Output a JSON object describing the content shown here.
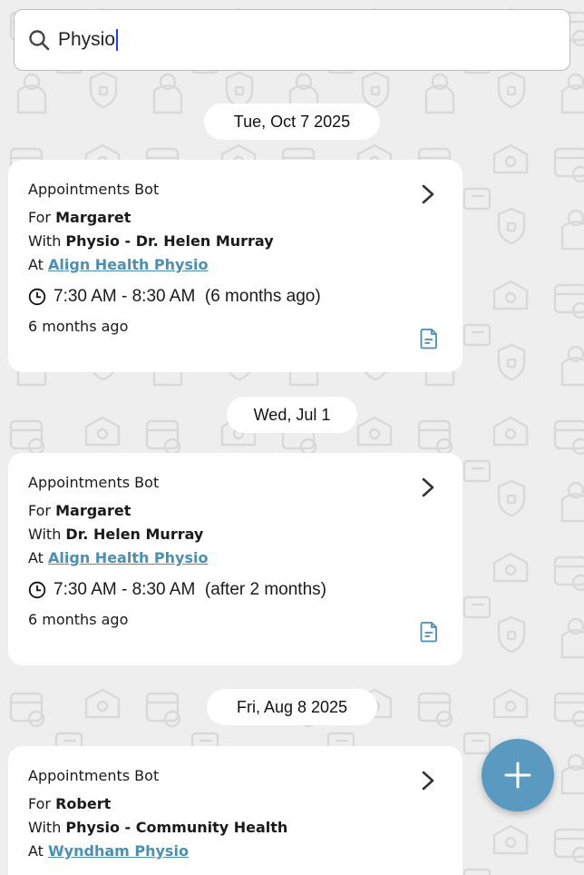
{
  "search": {
    "query": "Physio"
  },
  "groups": [
    {
      "date": "Tue, Oct 7 2025",
      "card": {
        "sender": "Appointments Bot",
        "for_prefix": "For",
        "for_name": "Margaret",
        "with_prefix": "With",
        "with_name": "Physio - Dr. Helen Murray",
        "at_prefix": "At",
        "at_place": "Align Health Physio",
        "time": "7:30 AM - 8:30 AM",
        "relative": "(6 months ago)",
        "ago": "6 months ago"
      }
    },
    {
      "date": "Wed, Jul 1",
      "card": {
        "sender": "Appointments Bot",
        "for_prefix": "For",
        "for_name": "Margaret",
        "with_prefix": "With",
        "with_name": "Dr. Helen Murray",
        "at_prefix": "At",
        "at_place": "Align Health Physio",
        "time": "7:30 AM - 8:30 AM",
        "relative": "(after 2 months)",
        "ago": "6 months ago"
      }
    },
    {
      "date": "Fri, Aug 8 2025",
      "card": {
        "sender": "Appointments Bot",
        "for_prefix": "For",
        "for_name": "Robert",
        "with_prefix": "With",
        "with_name": "Physio - Community Health",
        "at_prefix": "At",
        "at_place": "Wyndham Physio"
      }
    }
  ],
  "colors": {
    "background": "#eeeeee",
    "link": "#4a8fb4",
    "fab": "#5b9ac0",
    "caret": "#1e3cff"
  },
  "icons": [
    "search-icon",
    "chevron-right-icon",
    "clock-icon",
    "note-icon",
    "plus-icon"
  ]
}
